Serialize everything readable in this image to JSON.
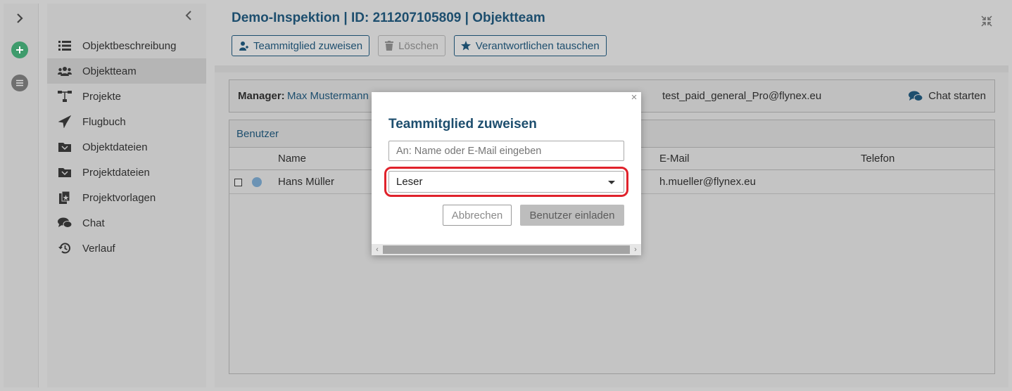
{
  "sidebar": {
    "items": [
      {
        "label": "Objektbeschreibung",
        "icon": "list-icon"
      },
      {
        "label": "Objektteam",
        "icon": "team-icon",
        "active": true
      },
      {
        "label": "Projekte",
        "icon": "hierarchy-icon"
      },
      {
        "label": "Flugbuch",
        "icon": "plane-icon"
      },
      {
        "label": "Objektdateien",
        "icon": "folder-icon"
      },
      {
        "label": "Projektdateien",
        "icon": "folder-icon"
      },
      {
        "label": "Projektvorlagen",
        "icon": "template-icon"
      },
      {
        "label": "Chat",
        "icon": "chat-icon"
      },
      {
        "label": "Verlauf",
        "icon": "history-icon"
      }
    ]
  },
  "header": {
    "title": "Demo-Inspektion | ID: 211207105809 | Objektteam",
    "toolbar": {
      "assign": "Teammitglied zuweisen",
      "delete": "Löschen",
      "swap": "Verantwortlichen tauschen"
    }
  },
  "manager": {
    "label": "Manager:",
    "name": "Max Mustermann",
    "email": "test_paid_general_Pro@flynex.eu",
    "chat": "Chat starten"
  },
  "users": {
    "tab": "Benutzer",
    "columns": {
      "name": "Name",
      "email": "E-Mail",
      "phone": "Telefon"
    },
    "rows": [
      {
        "name": "Hans Müller",
        "email": "h.mueller@flynex.eu",
        "phone": ""
      }
    ]
  },
  "modal": {
    "title": "Teammitglied zuweisen",
    "input_placeholder": "An: Name oder E-Mail eingeben",
    "role_selected": "Leser",
    "cancel": "Abbrechen",
    "invite": "Benutzer einladen"
  },
  "colors": {
    "accent": "#1d4e6e",
    "highlight": "#e0222b",
    "add_button": "#3e9b6c"
  }
}
